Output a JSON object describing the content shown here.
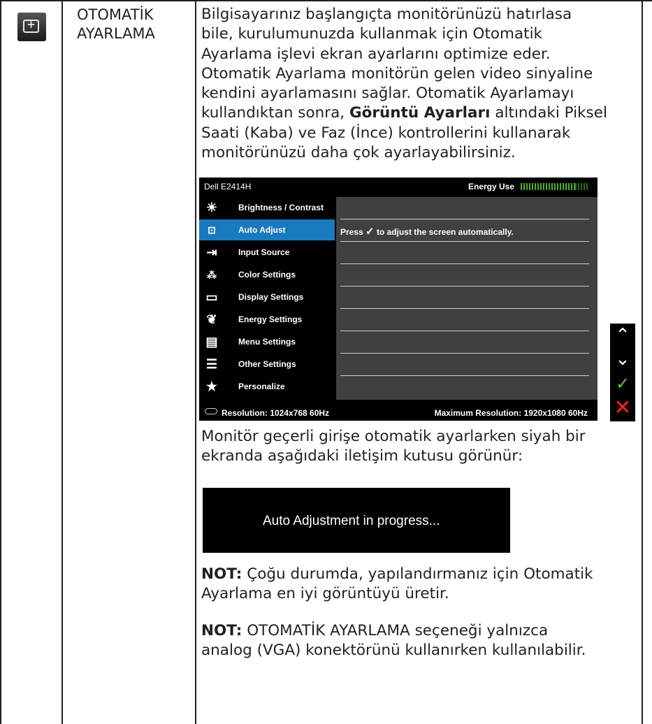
{
  "feature": {
    "icon": "auto-adjust-icon",
    "title_line1": "OTOMATİK",
    "title_line2": "AYARLAMA"
  },
  "description": {
    "p1_l1": "Bilgisayarınız başlangıçta monitörünüzü hatırlasa",
    "p1_l2": "bile, kurulumunuzda kullanmak için Otomatik",
    "p1_l3": "Ayarlama işlevi ekran ayarlarını optimize eder.",
    "p1_l4": "Otomatik Ayarlama monitörün gelen video sinyaline",
    "p1_l5": "kendini ayarlamasını sağlar. Otomatik Ayarlamayı",
    "p1_l6_pre": "kullandıktan sonra, ",
    "p1_l6_bold": "Görüntü Ayarları",
    "p1_l6_post": " altındaki Piksel",
    "p1_l7": "Saati (Kaba) ve Faz (İnce) kontrollerini kullanarak",
    "p1_l8": "monitörünüzü daha çok ayarlayabilirsiniz.",
    "p2_l1": "Monitör geçerli girişe otomatik ayarlarken siyah bir",
    "p2_l2": "ekranda aşağıdaki iletişim kutusu görünür:",
    "note1_label": "NOT:",
    "note1_l1": " Çoğu durumda, yapılandırmanız için Otomatik",
    "note1_l2": "Ayarlama en iyi görüntüyü üretir.",
    "note2_label": "NOT:",
    "note2_l1": " OTOMATİK AYARLAMA seçeneği yalnızca",
    "note2_l2": "analog (VGA) konektörünü kullanırken kullanılabilir."
  },
  "osd": {
    "model": "Dell E2414H",
    "energy_label": "Energy Use",
    "energy_level": 0.82,
    "menu": [
      {
        "label": "Brightness / Contrast",
        "icon": "brightness-icon"
      },
      {
        "label": "Auto Adjust",
        "icon": "auto-adjust-icon",
        "active": true
      },
      {
        "label": "Input Source",
        "icon": "input-source-icon"
      },
      {
        "label": "Color Settings",
        "icon": "color-settings-icon"
      },
      {
        "label": "Display Settings",
        "icon": "display-settings-icon"
      },
      {
        "label": "Energy Settings",
        "icon": "energy-settings-icon"
      },
      {
        "label": "Menu Settings",
        "icon": "menu-settings-icon"
      },
      {
        "label": "Other Settings",
        "icon": "other-settings-icon"
      },
      {
        "label": "Personalize",
        "icon": "star-icon"
      }
    ],
    "hint_pre": "Press",
    "hint_post": "to adjust the screen automatically.",
    "resolution": "Resolution: 1024x768 60Hz",
    "max_resolution": "Maximum Resolution: 1920x1080 60Hz"
  },
  "side_buttons": [
    "chevron-up-icon",
    "chevron-down-icon",
    "check-icon",
    "close-icon"
  ],
  "dialog_text": "Auto Adjustment in progress...",
  "colors": {
    "accent": "#1a7ac0",
    "panel": "#404040",
    "ok": "#5cc83e",
    "cancel": "#ff2020"
  }
}
